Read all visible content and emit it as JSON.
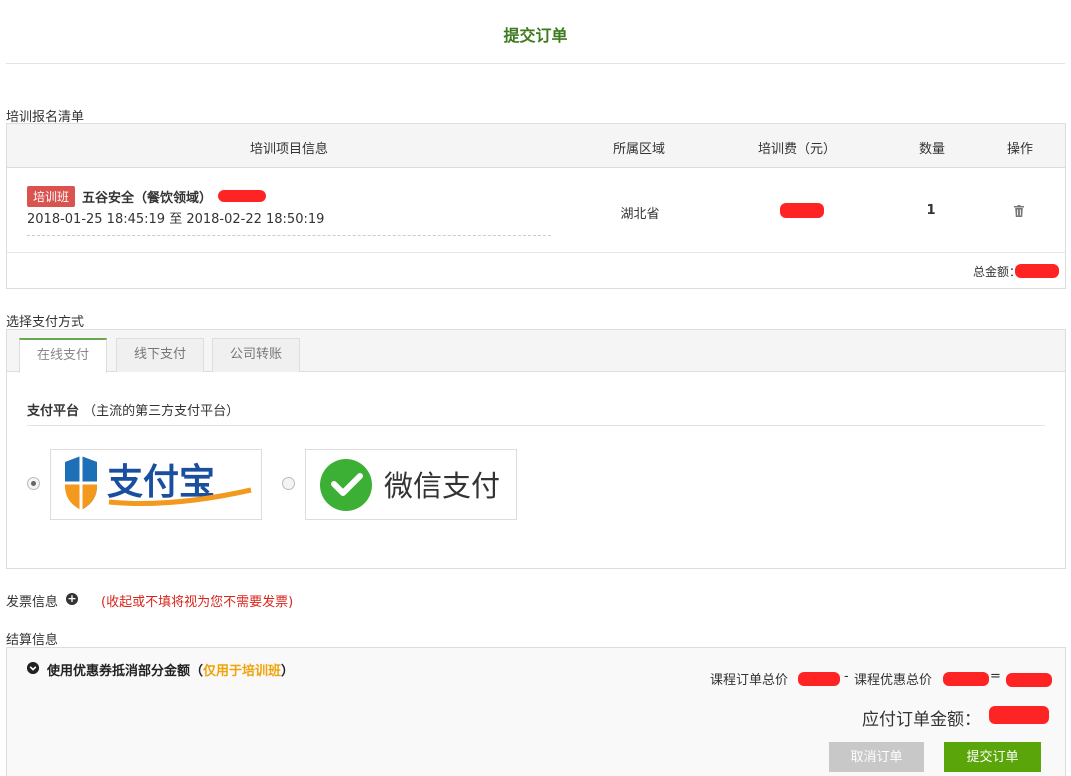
{
  "page": {
    "title": "提交订单"
  },
  "training": {
    "section_label": "培训报名清单",
    "columns": [
      "培训项目信息",
      "所属区域",
      "培训费（元）",
      "数量",
      "操作"
    ],
    "rows": [
      {
        "tag": "培训班",
        "name": "五谷安全（餐饮领域）",
        "date_range": "2018-01-25 18:45:19 至 2018-02-22 18:50:19",
        "region": "湖北省",
        "quantity": "1"
      }
    ],
    "total_label": "总金额："
  },
  "payment": {
    "section_label": "选择支付方式",
    "tabs": [
      "在线支付",
      "线下支付",
      "公司转账"
    ],
    "platform_title": "支付平台",
    "platform_note": "（主流的第三方支付平台）",
    "methods": [
      {
        "name": "支付宝",
        "icon": "alipay-logo",
        "checked": true
      },
      {
        "name": "微信支付",
        "icon": "wechat-pay-logo",
        "checked": false
      }
    ]
  },
  "invoice": {
    "label": "发票信息",
    "icon": "plus-circle-icon",
    "note": "(收起或不填将视为您不需要发票)"
  },
  "settlement": {
    "section_label": "结算信息",
    "coupon_prefix": "使用优惠券抵消部分金额（",
    "coupon_highlight": "仅用于培训班",
    "coupon_suffix": "）",
    "course_total_label": "课程订单总价",
    "minus": "-",
    "discount_label": "课程优惠总价",
    "equals": "=",
    "payable_label": "应付订单金额：",
    "cancel_label": "取消订单",
    "submit_label": "提交订单"
  },
  "colors": {
    "title_green": "#3e7a1e",
    "tag_red": "#d9534f",
    "note_red": "#d9261c",
    "highlight_orange": "#f0a30a",
    "submit_green": "#5aa50a",
    "cancel_gray": "#c8c8c8"
  }
}
